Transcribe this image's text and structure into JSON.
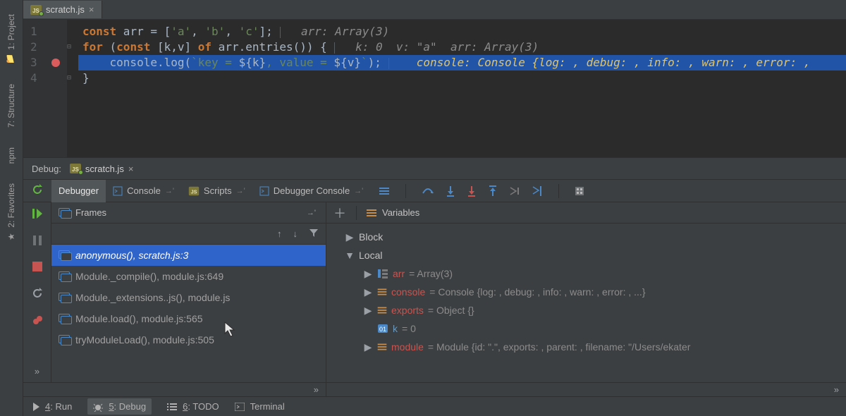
{
  "sidebar": {
    "tools": [
      {
        "label": "1: Project"
      },
      {
        "label": "7: Structure"
      },
      {
        "label": "npm"
      },
      {
        "label": "2: Favorites"
      }
    ]
  },
  "editor": {
    "tab": {
      "filename": "scratch.js"
    },
    "lines": [
      {
        "n": "1",
        "code": "const arr = ['a', 'b', 'c'];",
        "hint": "  arr: Array(3)"
      },
      {
        "n": "2",
        "code": "for (const [k,v] of arr.entries()) {",
        "hint": "  k: 0  v: \"a\"  arr: Array(3)"
      },
      {
        "n": "3",
        "bp": true,
        "exec": true,
        "code": "    console.log(`key = ${k}, value = ${v}`);",
        "hint": "   console: Console {log: , debug: , info: , warn: , error: ,"
      },
      {
        "n": "4",
        "code": "}",
        "hint": ""
      }
    ]
  },
  "debug": {
    "title": "Debug:",
    "config": "scratch.js",
    "tabs": {
      "debugger": "Debugger",
      "console": "Console",
      "scripts": "Scripts",
      "dconsole": "Debugger Console"
    },
    "panes": {
      "frames": "Frames",
      "variables": "Variables"
    },
    "frames": [
      {
        "label": "anonymous(), scratch.js:3",
        "selected": true,
        "italic": true
      },
      {
        "label": "Module._compile(), module.js:649"
      },
      {
        "label": "Module._extensions..js(), module.js"
      },
      {
        "label": "Module.load(), module.js:565"
      },
      {
        "label": "tryModuleLoad(), module.js:505"
      }
    ],
    "variables": {
      "block": "Block",
      "local": "Local",
      "items": [
        {
          "name": "arr",
          "value": "= Array(3)"
        },
        {
          "name": "console",
          "value": "= Console {log: , debug: , info: , warn: , error: , ...}"
        },
        {
          "name": "exports",
          "value": "= Object {}"
        },
        {
          "name": "k",
          "value": "= 0",
          "blue": true
        },
        {
          "name": "module",
          "value": "= Module {id: \".\", exports: , parent: , filename: \"/Users/ekater"
        }
      ]
    }
  },
  "status": {
    "run": "4: Run",
    "debug": "5: Debug",
    "todo": "6: TODO",
    "terminal": "Terminal"
  }
}
